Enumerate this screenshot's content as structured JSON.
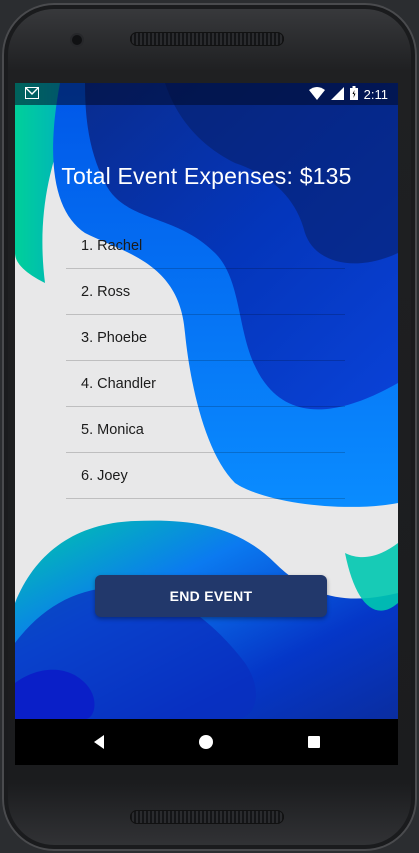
{
  "statusbar": {
    "time": "2:11",
    "notification_icon": "gmail-icon",
    "icons": [
      "wifi-icon",
      "cell-signal-icon",
      "battery-icon"
    ]
  },
  "main": {
    "title": "Total Event Expenses: $135",
    "participants": [
      "1. Rachel",
      "2. Ross",
      "3. Phoebe",
      "4. Chandler",
      "5. Monica",
      "6. Joey"
    ],
    "end_button_label": "END EVENT"
  },
  "navbar": {
    "buttons": [
      "back-icon",
      "home-icon",
      "recents-icon"
    ]
  },
  "colors": {
    "button": "#22386b",
    "wallpaper_blue": "#0050e6",
    "wallpaper_green": "#00c2a0"
  }
}
